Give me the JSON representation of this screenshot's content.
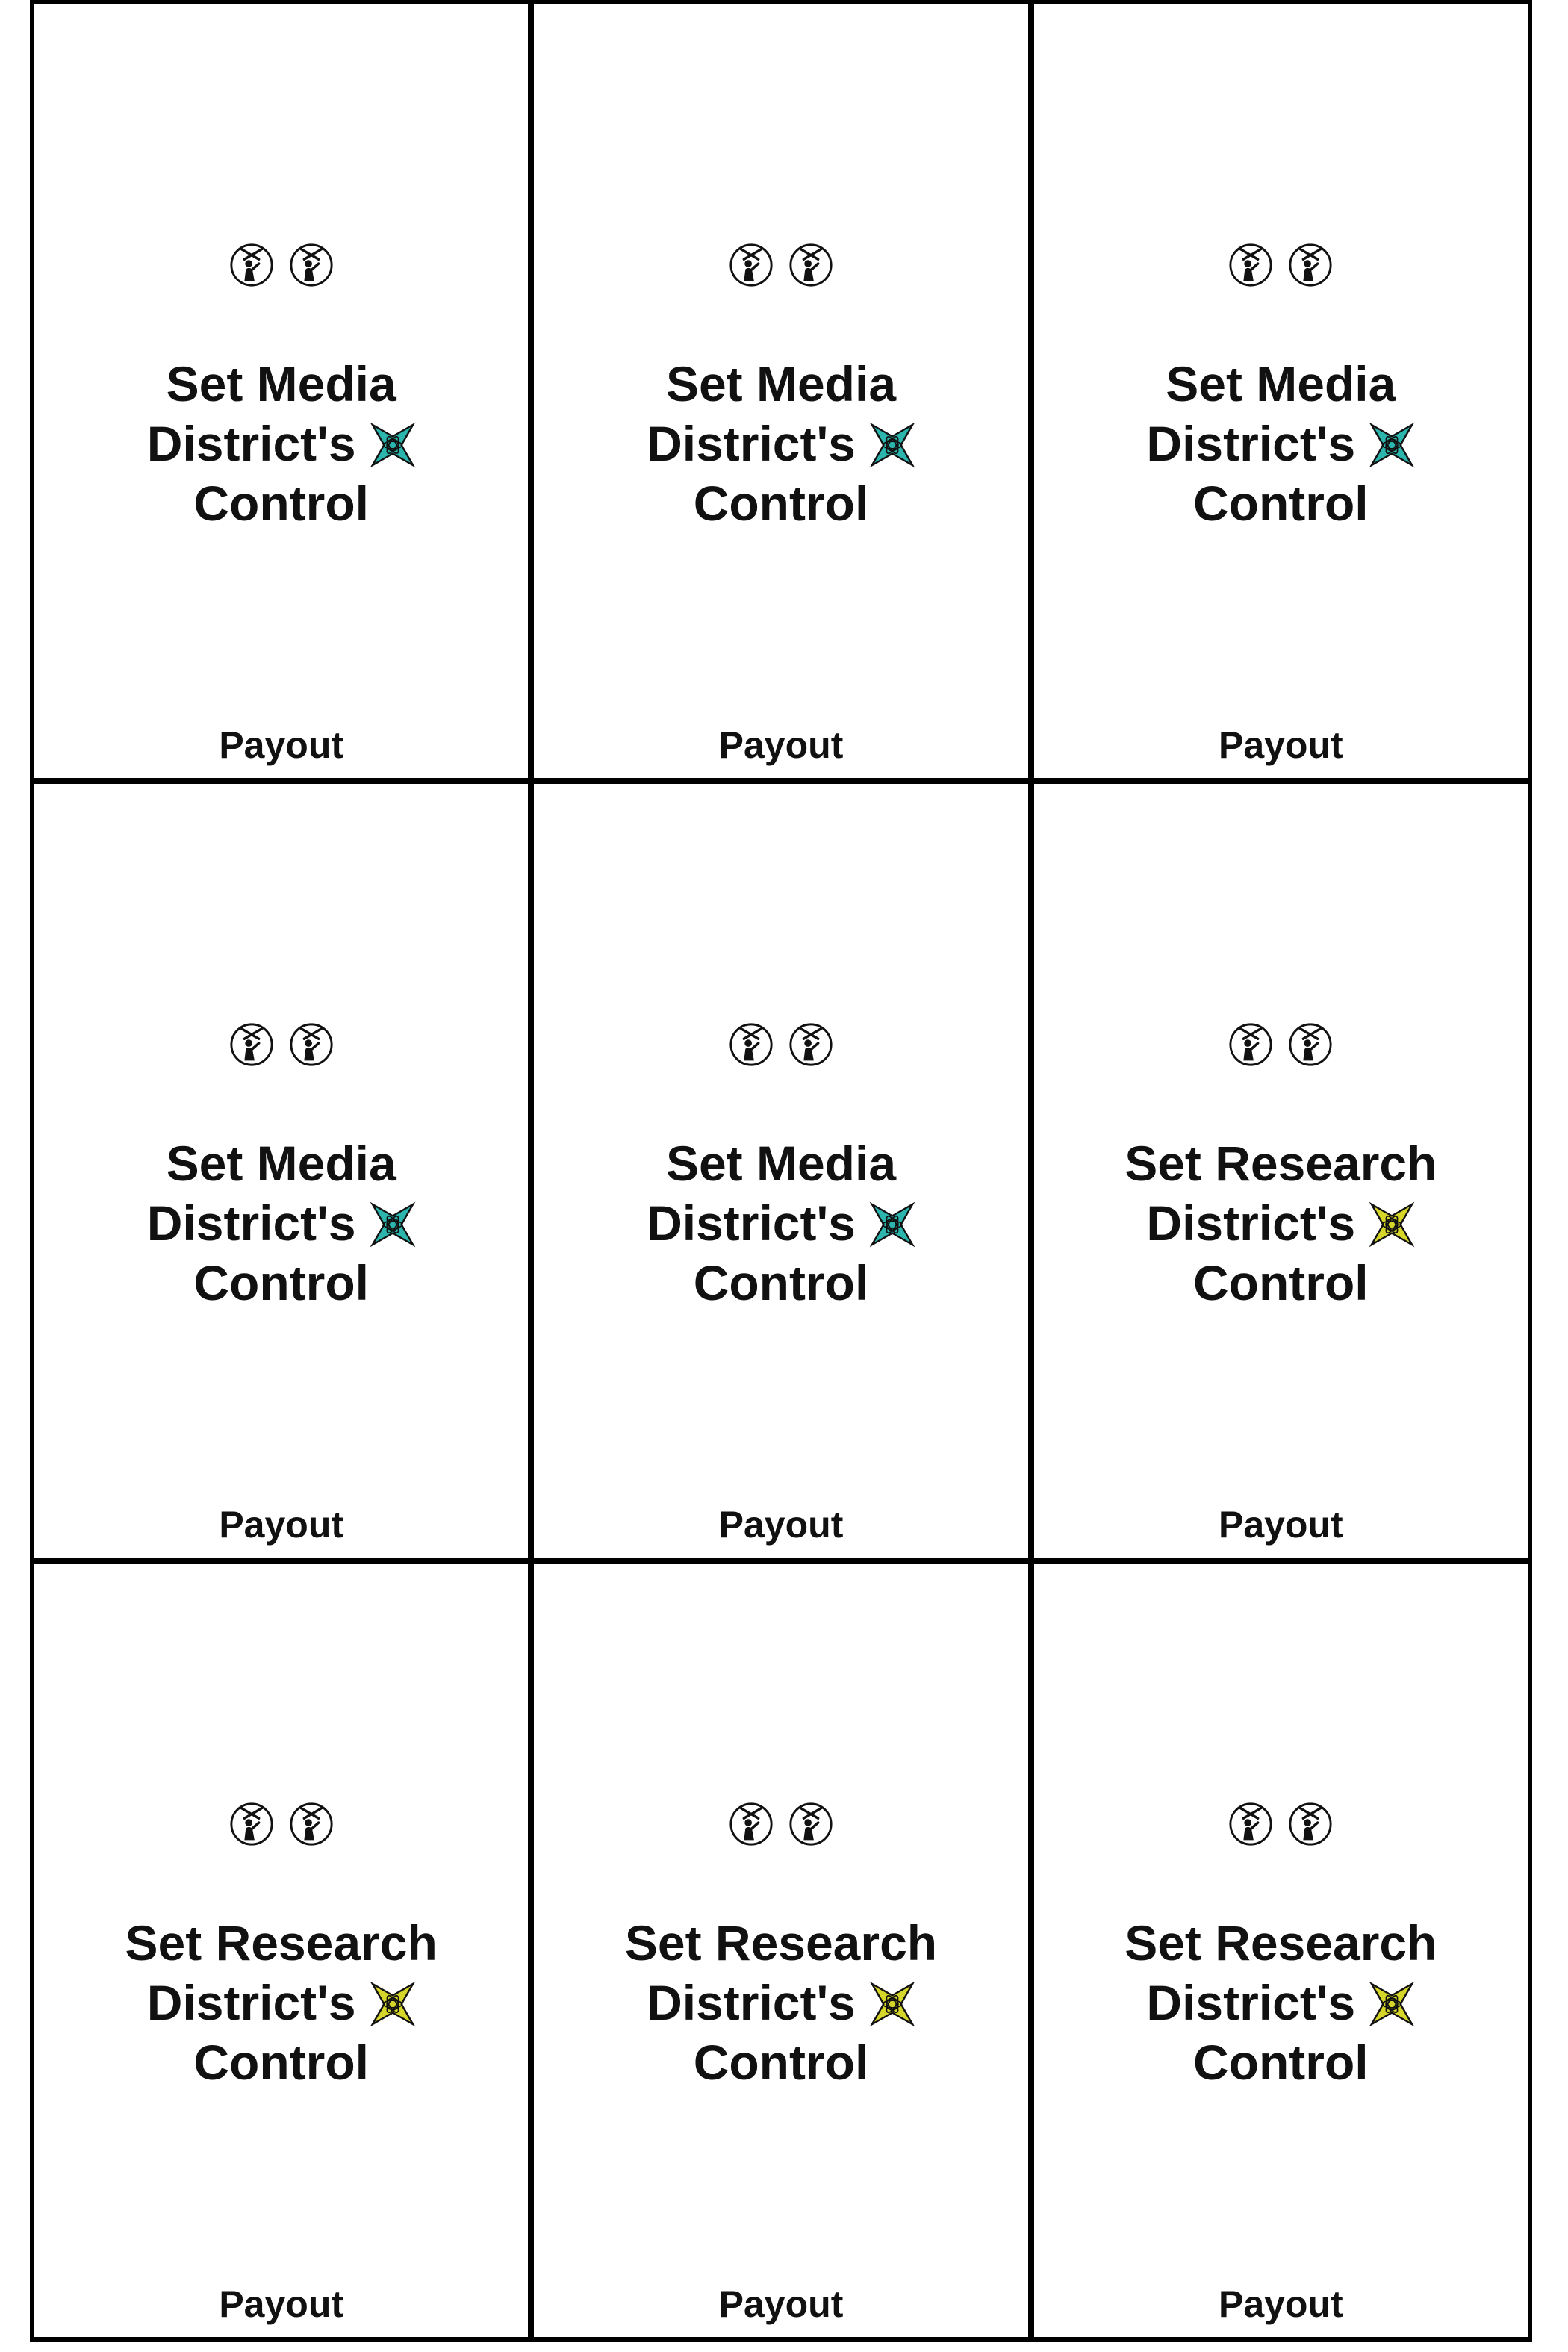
{
  "cards": [
    {
      "title_line1": "Set Media",
      "title_line2": "District's",
      "title_line3": "Control",
      "payout_label": "Payout",
      "district": "media",
      "district_icon": "media-district-star-icon",
      "district_color": "#2bb5ad",
      "agent_icons": [
        "spy-agent-icon",
        "spy-agent-icon"
      ]
    },
    {
      "title_line1": "Set Media",
      "title_line2": "District's",
      "title_line3": "Control",
      "payout_label": "Payout",
      "district": "media",
      "district_icon": "media-district-star-icon",
      "district_color": "#2bb5ad",
      "agent_icons": [
        "spy-agent-icon",
        "spy-agent-icon"
      ]
    },
    {
      "title_line1": "Set Media",
      "title_line2": "District's",
      "title_line3": "Control",
      "payout_label": "Payout",
      "district": "media",
      "district_icon": "media-district-star-icon",
      "district_color": "#2bb5ad",
      "agent_icons": [
        "spy-agent-icon",
        "spy-agent-icon"
      ]
    },
    {
      "title_line1": "Set Media",
      "title_line2": "District's",
      "title_line3": "Control",
      "payout_label": "Payout",
      "district": "media",
      "district_icon": "media-district-star-icon",
      "district_color": "#2bb5ad",
      "agent_icons": [
        "spy-agent-icon",
        "spy-agent-icon"
      ]
    },
    {
      "title_line1": "Set Media",
      "title_line2": "District's",
      "title_line3": "Control",
      "payout_label": "Payout",
      "district": "media",
      "district_icon": "media-district-star-icon",
      "district_color": "#2bb5ad",
      "agent_icons": [
        "spy-agent-icon",
        "spy-agent-icon"
      ]
    },
    {
      "title_line1": "Set Research",
      "title_line2": "District's",
      "title_line3": "Control",
      "payout_label": "Payout",
      "district": "research",
      "district_icon": "research-district-star-icon",
      "district_color": "#d6d62a",
      "agent_icons": [
        "spy-agent-icon",
        "spy-agent-icon"
      ]
    },
    {
      "title_line1": "Set Research",
      "title_line2": "District's",
      "title_line3": "Control",
      "payout_label": "Payout",
      "district": "research",
      "district_icon": "research-district-star-icon",
      "district_color": "#d6d62a",
      "agent_icons": [
        "spy-agent-icon",
        "spy-agent-icon"
      ]
    },
    {
      "title_line1": "Set Research",
      "title_line2": "District's",
      "title_line3": "Control",
      "payout_label": "Payout",
      "district": "research",
      "district_icon": "research-district-star-icon",
      "district_color": "#d6d62a",
      "agent_icons": [
        "spy-agent-icon",
        "spy-agent-icon"
      ]
    },
    {
      "title_line1": "Set Research",
      "title_line2": "District's",
      "title_line3": "Control",
      "payout_label": "Payout",
      "district": "research",
      "district_icon": "research-district-star-icon",
      "district_color": "#d6d62a",
      "agent_icons": [
        "spy-agent-icon",
        "spy-agent-icon"
      ]
    }
  ]
}
